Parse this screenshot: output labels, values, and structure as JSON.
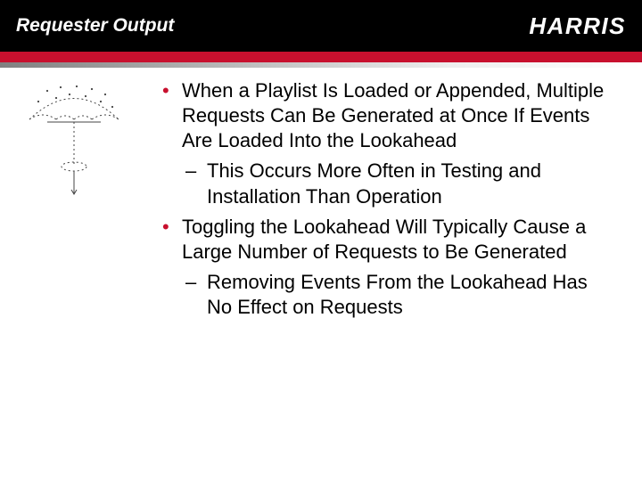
{
  "header": {
    "title": "Requester Output",
    "logo": "HARRIS"
  },
  "bullets": {
    "b1_1": "When a Playlist Is Loaded or Appended, Multiple Requests Can Be Generated at Once If Events Are Loaded Into the Lookahead",
    "b2_1": "This Occurs More Often in Testing and Installation Than Operation",
    "b1_2": "Toggling the Lookahead Will Typically Cause a Large Number of Requests to Be Generated",
    "b2_2": "Removing Events From the Lookahead Has No Effect on Requests"
  }
}
